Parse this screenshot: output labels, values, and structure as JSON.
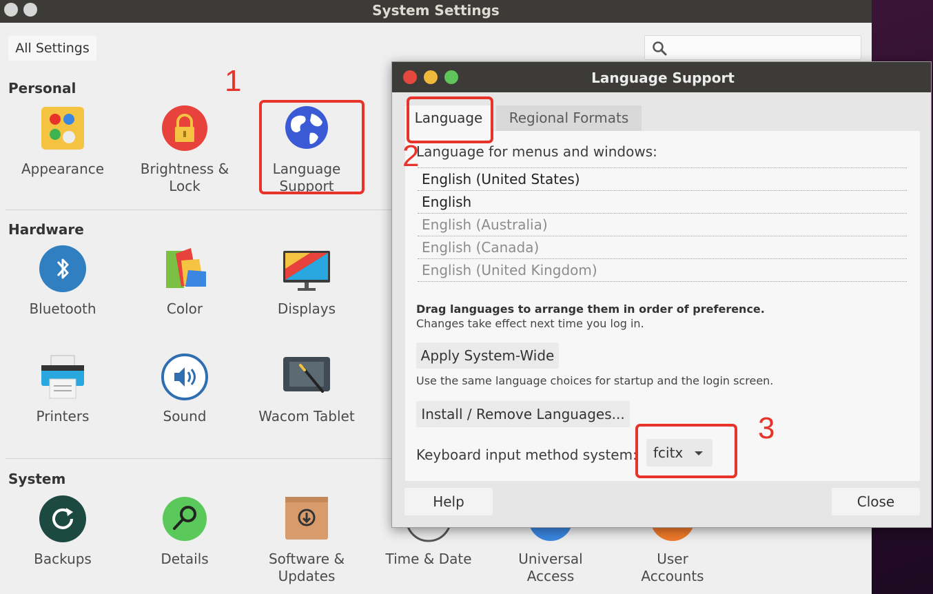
{
  "main_window": {
    "title": "System Settings",
    "all_settings_label": "All Settings",
    "search": {
      "placeholder": ""
    }
  },
  "sections": {
    "personal": "Personal",
    "hardware": "Hardware",
    "system": "System"
  },
  "personal_items": {
    "appearance": "Appearance",
    "brightness_1": "Brightness &",
    "brightness_2": "Lock",
    "language_1": "Language",
    "language_2": "Support"
  },
  "hardware_items": {
    "bluetooth": "Bluetooth",
    "color": "Color",
    "displays": "Displays",
    "printers": "Printers",
    "sound": "Sound",
    "wacom": "Wacom Tablet"
  },
  "system_items": {
    "backups": "Backups",
    "details": "Details",
    "software_1": "Software &",
    "software_2": "Updates",
    "time_date": "Time & Date",
    "universal_1": "Universal",
    "universal_2": "Access",
    "user_1": "User",
    "user_2": "Accounts"
  },
  "annotations": {
    "n1": "1",
    "n2": "2",
    "n3": "3"
  },
  "dialog": {
    "title": "Language Support",
    "tabs": {
      "language": "Language",
      "regional": "Regional Formats"
    },
    "heading": "Language for menus and windows:",
    "languages": [
      "English (United States)",
      "English",
      "English (Australia)",
      "English (Canada)",
      "English (United Kingdom)"
    ],
    "drag_note": "Drag languages to arrange them in order of preference.",
    "changes_note": "Changes take effect next time you log in.",
    "apply_button": "Apply System-Wide",
    "apply_note": "Use the same language choices for startup and the login screen.",
    "install_button": "Install / Remove Languages...",
    "keyboard_label": "Keyboard input method system:",
    "keyboard_value": "fcitx",
    "help_button": "Help",
    "close_button": "Close"
  },
  "colors": {
    "titlebar": "#3c3b37",
    "annotation_red": "#e8332a",
    "close_red": "#e6483e",
    "min_yellow": "#f0b93b",
    "max_green": "#5fc45a"
  }
}
